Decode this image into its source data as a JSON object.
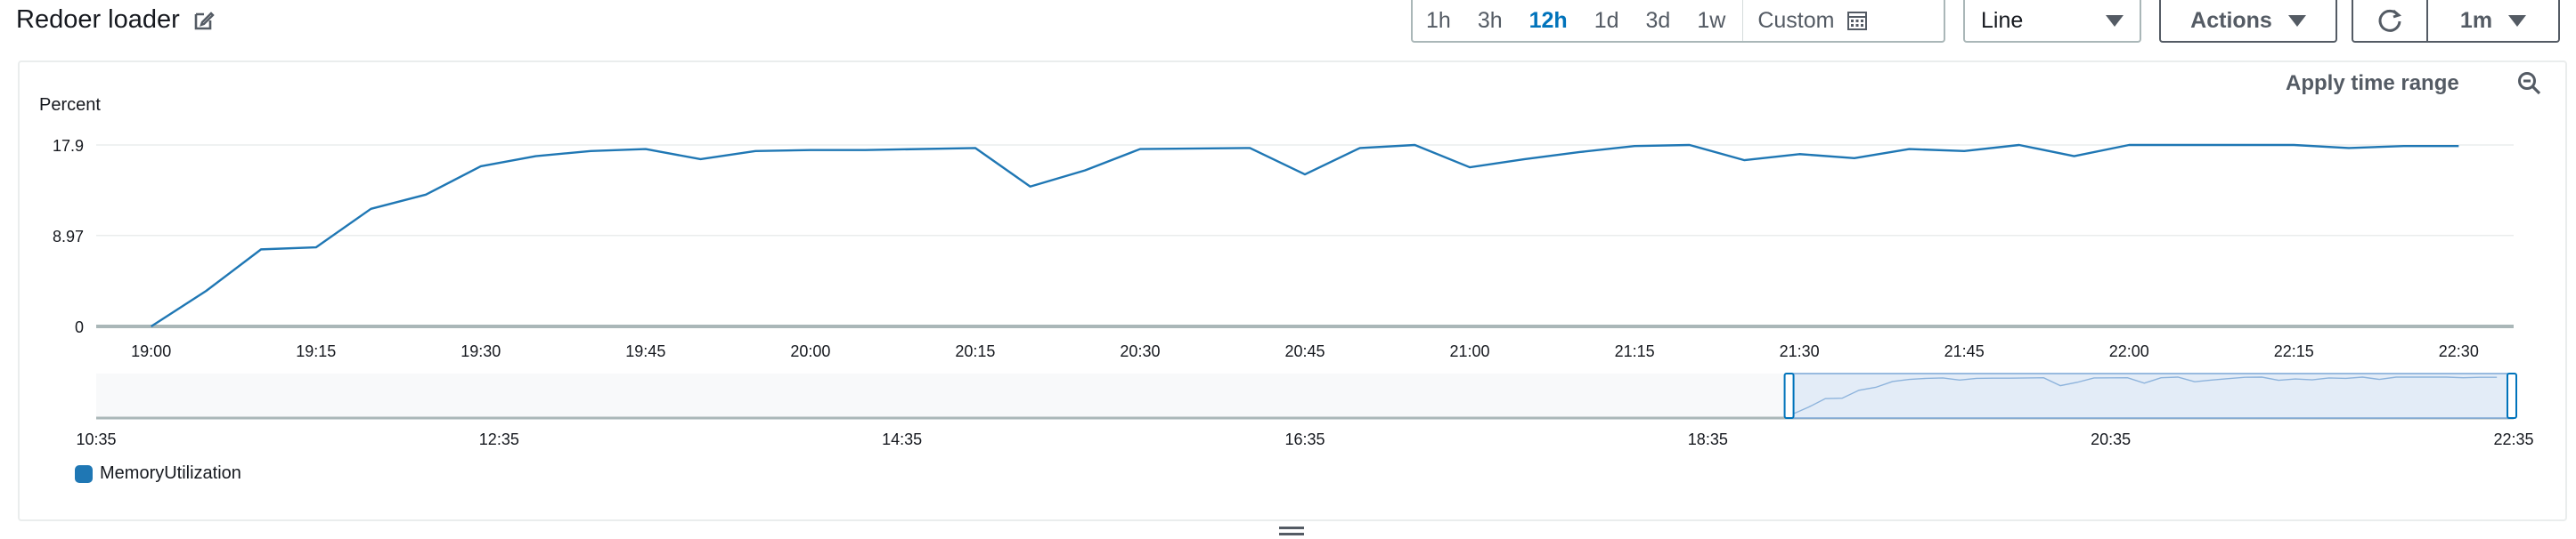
{
  "header": {
    "title": "Redoer loader",
    "ranges": [
      "1h",
      "3h",
      "12h",
      "1d",
      "3d",
      "1w"
    ],
    "active_range": "12h",
    "custom_label": "Custom",
    "chart_type": "Line",
    "actions_label": "Actions",
    "interval_label": "1m"
  },
  "panel": {
    "apply_time_range": "Apply time range",
    "y_unit": "Percent"
  },
  "colors": {
    "series": "#1f77b4",
    "active_range": "#0073bb",
    "selection_fill": "#e3ecf7"
  },
  "icons": [
    "edit-icon",
    "calendar-icon",
    "caret-down-icon",
    "refresh-icon",
    "zoom-out-icon",
    "drag-handle-icon"
  ],
  "chart_data": {
    "type": "line",
    "ylabel": "Percent",
    "yticks": [
      0,
      8.97,
      17.9
    ],
    "ylim": [
      0,
      17.9
    ],
    "xticks": [
      "19:00",
      "19:15",
      "19:30",
      "19:45",
      "20:00",
      "20:15",
      "20:30",
      "20:45",
      "21:00",
      "21:15",
      "21:30",
      "21:45",
      "22:00",
      "22:15",
      "22:30"
    ],
    "xlim_minutes_from_19_00": [
      -5,
      215
    ],
    "series": [
      {
        "name": "MemoryUtilization",
        "x_minutes_from_19_00": [
          0,
          5,
          10,
          15,
          20,
          25,
          30,
          35,
          40,
          45,
          50,
          55,
          60,
          65,
          75,
          80,
          85,
          90,
          100,
          105,
          110,
          115,
          120,
          125,
          130,
          135,
          140,
          145,
          150,
          155,
          160,
          165,
          170,
          175,
          180,
          185,
          190,
          195,
          200,
          205,
          210
        ],
        "values": [
          0,
          3.5,
          7.6,
          7.8,
          11.6,
          13,
          15.8,
          16.8,
          17.3,
          17.5,
          16.5,
          17.3,
          17.4,
          17.4,
          17.6,
          13.8,
          15.4,
          17.5,
          17.6,
          15,
          17.6,
          17.9,
          15.7,
          16.5,
          17.2,
          17.8,
          17.9,
          16.4,
          17,
          16.6,
          17.5,
          17.3,
          17.9,
          16.8,
          17.9,
          17.9,
          17.9,
          17.9,
          17.6,
          17.8,
          17.8
        ]
      }
    ],
    "navigator": {
      "ticks": [
        "10:35",
        "12:35",
        "14:35",
        "16:35",
        "18:35",
        "20:35",
        "22:35"
      ],
      "selection": [
        "19:00",
        "22:35"
      ]
    },
    "legend": [
      "MemoryUtilization"
    ],
    "grid": true
  }
}
